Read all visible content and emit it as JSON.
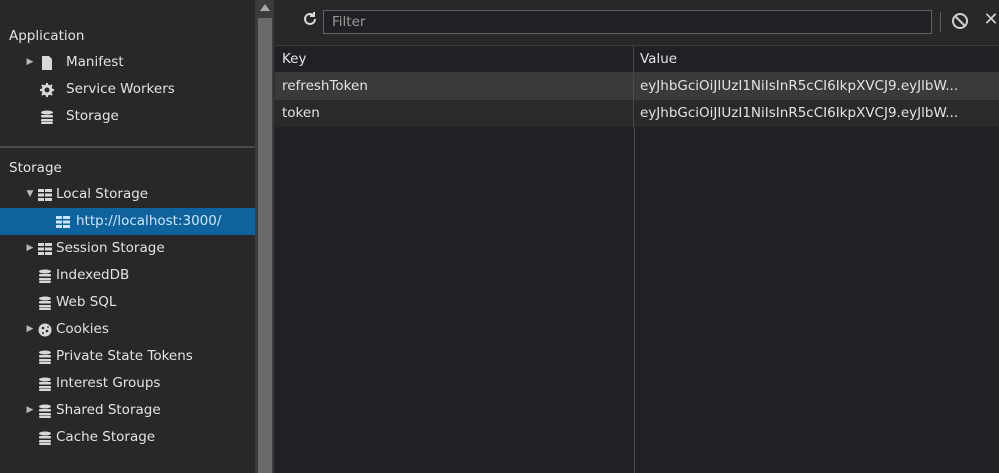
{
  "sidebar": {
    "application_title": "Application",
    "application_items": [
      {
        "label": "Manifest",
        "icon": "document-icon"
      },
      {
        "label": "Service Workers",
        "icon": "gear-icon"
      },
      {
        "label": "Storage",
        "icon": "database-icon"
      }
    ],
    "storage_title": "Storage",
    "storage_items": [
      {
        "label": "Local Storage",
        "icon": "grid-icon",
        "expanded": true
      },
      {
        "label": "http://localhost:3000/",
        "icon": "grid-icon",
        "selected": true
      },
      {
        "label": "Session Storage",
        "icon": "grid-icon"
      },
      {
        "label": "IndexedDB",
        "icon": "database-icon"
      },
      {
        "label": "Web SQL",
        "icon": "database-icon"
      },
      {
        "label": "Cookies",
        "icon": "cookie-icon"
      },
      {
        "label": "Private State Tokens",
        "icon": "database-icon"
      },
      {
        "label": "Interest Groups",
        "icon": "database-icon"
      },
      {
        "label": "Shared Storage",
        "icon": "database-icon"
      },
      {
        "label": "Cache Storage",
        "icon": "database-icon"
      }
    ]
  },
  "toolbar": {
    "refresh_icon": "refresh-icon",
    "filter_placeholder": "Filter",
    "filter_value": "",
    "clear_all_icon": "block-icon",
    "delete_icon": "close-icon"
  },
  "table": {
    "columns": [
      "Key",
      "Value"
    ],
    "rows": [
      {
        "key": "refreshToken",
        "value": "eyJhbGciOiJIUzI1NiIsInR5cCI6IkpXVCJ9.eyJlbW..."
      },
      {
        "key": "token",
        "value": "eyJhbGciOiJIUzI1NiIsInR5cCI6IkpXVCJ9.eyJlbW..."
      }
    ]
  },
  "colors": {
    "selection": "#0e639c",
    "background": "#202124",
    "sidebar": "#282828"
  }
}
